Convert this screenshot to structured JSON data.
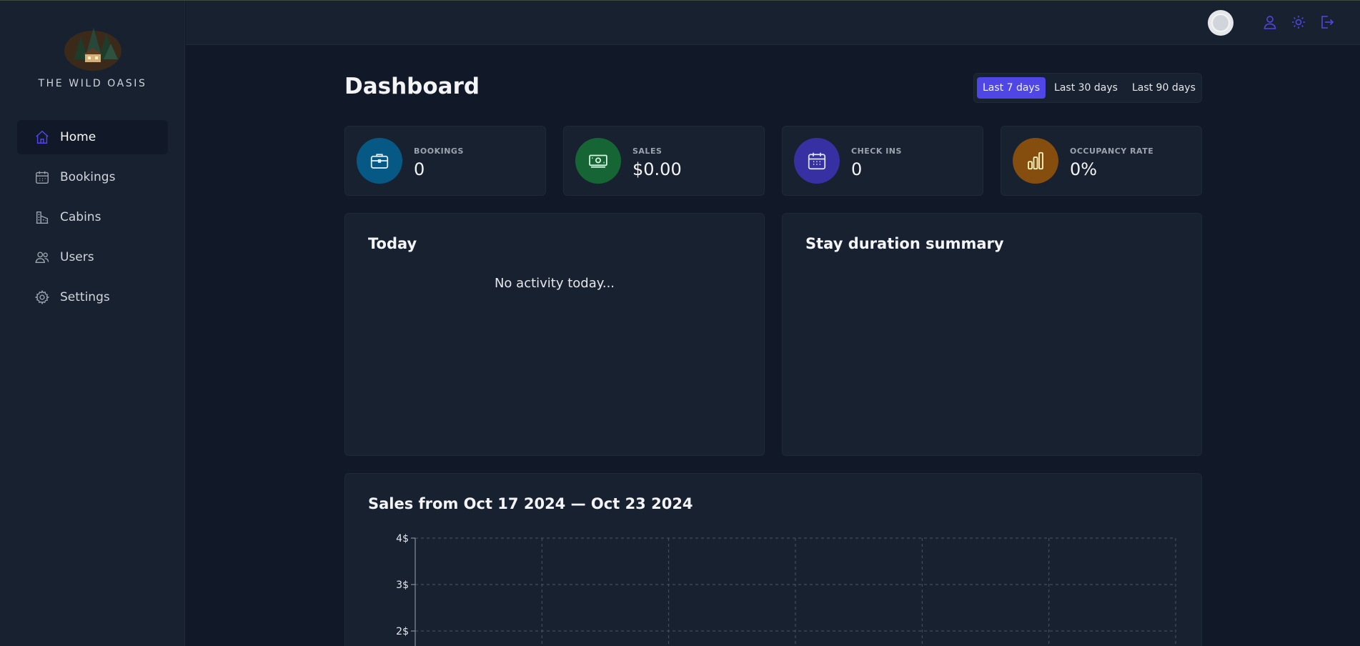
{
  "brand": {
    "name": "THE WILD OASIS"
  },
  "sidebar": {
    "items": [
      {
        "label": "Home",
        "icon": "home-icon",
        "active": true
      },
      {
        "label": "Bookings",
        "icon": "calendar-icon",
        "active": false
      },
      {
        "label": "Cabins",
        "icon": "building-icon",
        "active": false
      },
      {
        "label": "Users",
        "icon": "users-icon",
        "active": false
      },
      {
        "label": "Settings",
        "icon": "gear-icon",
        "active": false
      }
    ]
  },
  "header": {
    "icons": [
      "avatar",
      "user-icon",
      "sun-icon",
      "logout-icon"
    ]
  },
  "page": {
    "title": "Dashboard"
  },
  "filter": {
    "options": [
      "Last 7 days",
      "Last 30 days",
      "Last 90 days"
    ],
    "active": "Last 7 days"
  },
  "stats": [
    {
      "title": "BOOKINGS",
      "value": "0",
      "icon": "briefcase-icon",
      "color": "#075985"
    },
    {
      "title": "SALES",
      "value": "$0.00",
      "icon": "banknotes-icon",
      "color": "#166534"
    },
    {
      "title": "CHECK INS",
      "value": "0",
      "icon": "calendar-days-icon",
      "color": "#3730a3"
    },
    {
      "title": "OCCUPANCY RATE",
      "value": "0%",
      "icon": "chart-bar-icon",
      "color": "#854d0e"
    }
  ],
  "today": {
    "title": "Today",
    "empty_text": "No activity today..."
  },
  "stay_duration": {
    "title": "Stay duration summary"
  },
  "sales_chart": {
    "title": "Sales from Oct 17 2024 — Oct 23 2024"
  },
  "chart_data": {
    "type": "area",
    "title": "Sales from Oct 17 2024 — Oct 23 2024",
    "xlabel": "",
    "ylabel": "",
    "y_ticks": [
      "4$",
      "3$",
      "2$"
    ],
    "ylim": [
      0,
      4
    ],
    "grid": true,
    "series": []
  },
  "colors": {
    "accent": "#4f46e5",
    "background": "#111827",
    "panel": "#18212f"
  }
}
